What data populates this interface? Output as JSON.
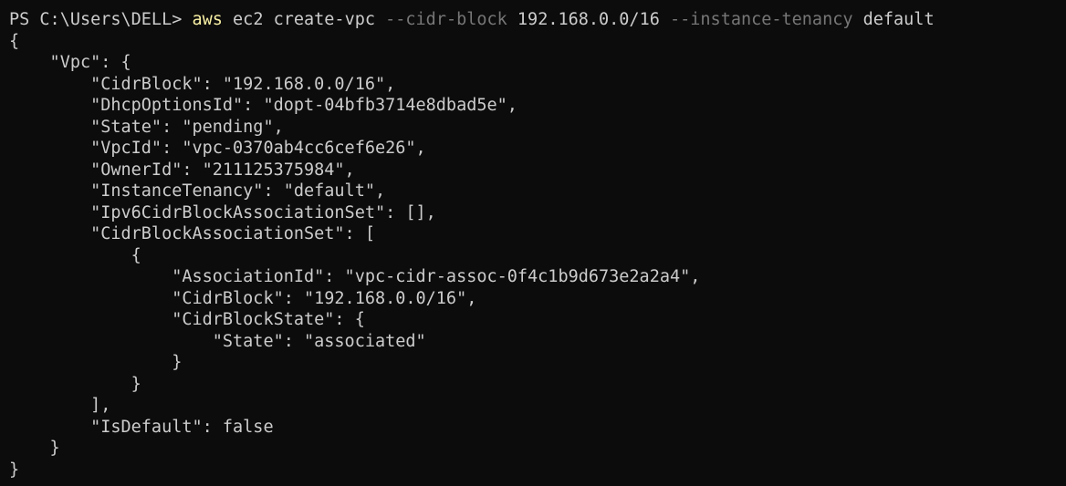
{
  "terminal": {
    "prompt": "PS C:\\Users\\DELL> ",
    "command": {
      "program": "aws",
      "sep1": " ",
      "arg1": "ec2 create-vpc ",
      "flag1": "--cidr-block",
      "arg2": " 192.168.0.0/16 ",
      "flag2": "--instance-tenancy",
      "arg3": " default"
    },
    "output_lines": [
      "{",
      "    \"Vpc\": {",
      "        \"CidrBlock\": \"192.168.0.0/16\",",
      "        \"DhcpOptionsId\": \"dopt-04bfb3714e8dbad5e\",",
      "        \"State\": \"pending\",",
      "        \"VpcId\": \"vpc-0370ab4cc6cef6e26\",",
      "        \"OwnerId\": \"211125375984\",",
      "        \"InstanceTenancy\": \"default\",",
      "        \"Ipv6CidrBlockAssociationSet\": [],",
      "        \"CidrBlockAssociationSet\": [",
      "            {",
      "                \"AssociationId\": \"vpc-cidr-assoc-0f4c1b9d673e2a2a4\",",
      "                \"CidrBlock\": \"192.168.0.0/16\",",
      "                \"CidrBlockState\": {",
      "                    \"State\": \"associated\"",
      "                }",
      "            }",
      "        ],",
      "        \"IsDefault\": false",
      "    }",
      "}"
    ]
  },
  "colors": {
    "background": "#0c0c0c",
    "text": "#cccccc",
    "command": "#f9f1a5",
    "flag": "#767676"
  }
}
